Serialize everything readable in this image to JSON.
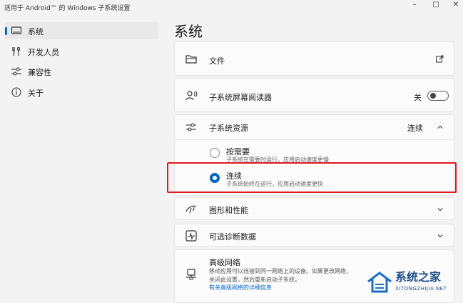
{
  "window": {
    "title": "适用于 Android™ 的 Windows 子系统设置",
    "minimize": "–",
    "maximize": "□",
    "close": "✕"
  },
  "sidebar": {
    "items": [
      {
        "label": "系统",
        "icon": "monitor-icon",
        "active": true
      },
      {
        "label": "开发人员",
        "icon": "tools-icon",
        "active": false
      },
      {
        "label": "兼容性",
        "icon": "sliders-icon",
        "active": false
      },
      {
        "label": "关于",
        "icon": "info-icon",
        "active": false
      }
    ]
  },
  "main": {
    "page_title": "系统",
    "files": {
      "label": "文件"
    },
    "screen_reader": {
      "label": "子系统屏幕阅读器",
      "toggle_text": "关",
      "toggle_on": false
    },
    "resources": {
      "label": "子系统资源",
      "value": "连续",
      "options": [
        {
          "title": "按需要",
          "desc": "子系统在需要时运行，应用启动速度更慢",
          "selected": false
        },
        {
          "title": "连续",
          "desc": "子系统始终在运行，应用启动速度更快",
          "selected": true
        }
      ]
    },
    "graphics": {
      "label": "图形和性能"
    },
    "diagnostics": {
      "label": "可选诊断数据"
    },
    "network": {
      "label": "高级网络",
      "desc_line1": "移动应用可以连接到同一网络上的设备。如果更改网络，",
      "desc_line2": "关闭此设置，然后重新启动子系统。",
      "link": "有关高级网络的详细信息"
    }
  },
  "watermark": {
    "text": "系统之家",
    "sub": "XITONGZHIJIA.NET"
  },
  "colors": {
    "accent": "#0067c0",
    "highlight_box": "#e0191f",
    "background": "#f3f3f3",
    "card": "#fbfbfb"
  }
}
